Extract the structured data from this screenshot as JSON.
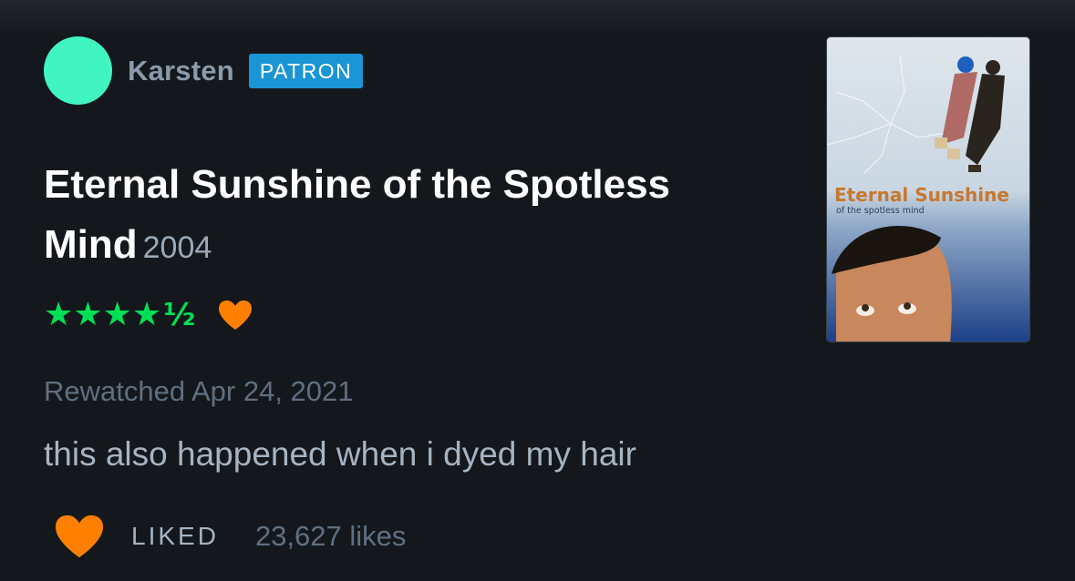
{
  "user": {
    "name": "Karsten",
    "badge": "PATRON",
    "avatar_color": "#40f5c0"
  },
  "film": {
    "title": "Eternal Sunshine of the Spotless Mind",
    "year": "2004",
    "poster_title": "Eternal Sunshine",
    "poster_subtitle": "of the spotless mind"
  },
  "rating": {
    "value": 4.5,
    "max": 5,
    "stars_text": "★★★★",
    "half_text": "½",
    "star_color": "#00e054",
    "liked_heart_color": "#ff8000"
  },
  "review": {
    "watched_label": "Rewatched Apr 24, 2021",
    "text": "this also happened when i dyed my hair"
  },
  "actions": {
    "liked_label": "LIKED",
    "likes_count": "23,627 likes",
    "heart_icon": "heart-icon"
  }
}
